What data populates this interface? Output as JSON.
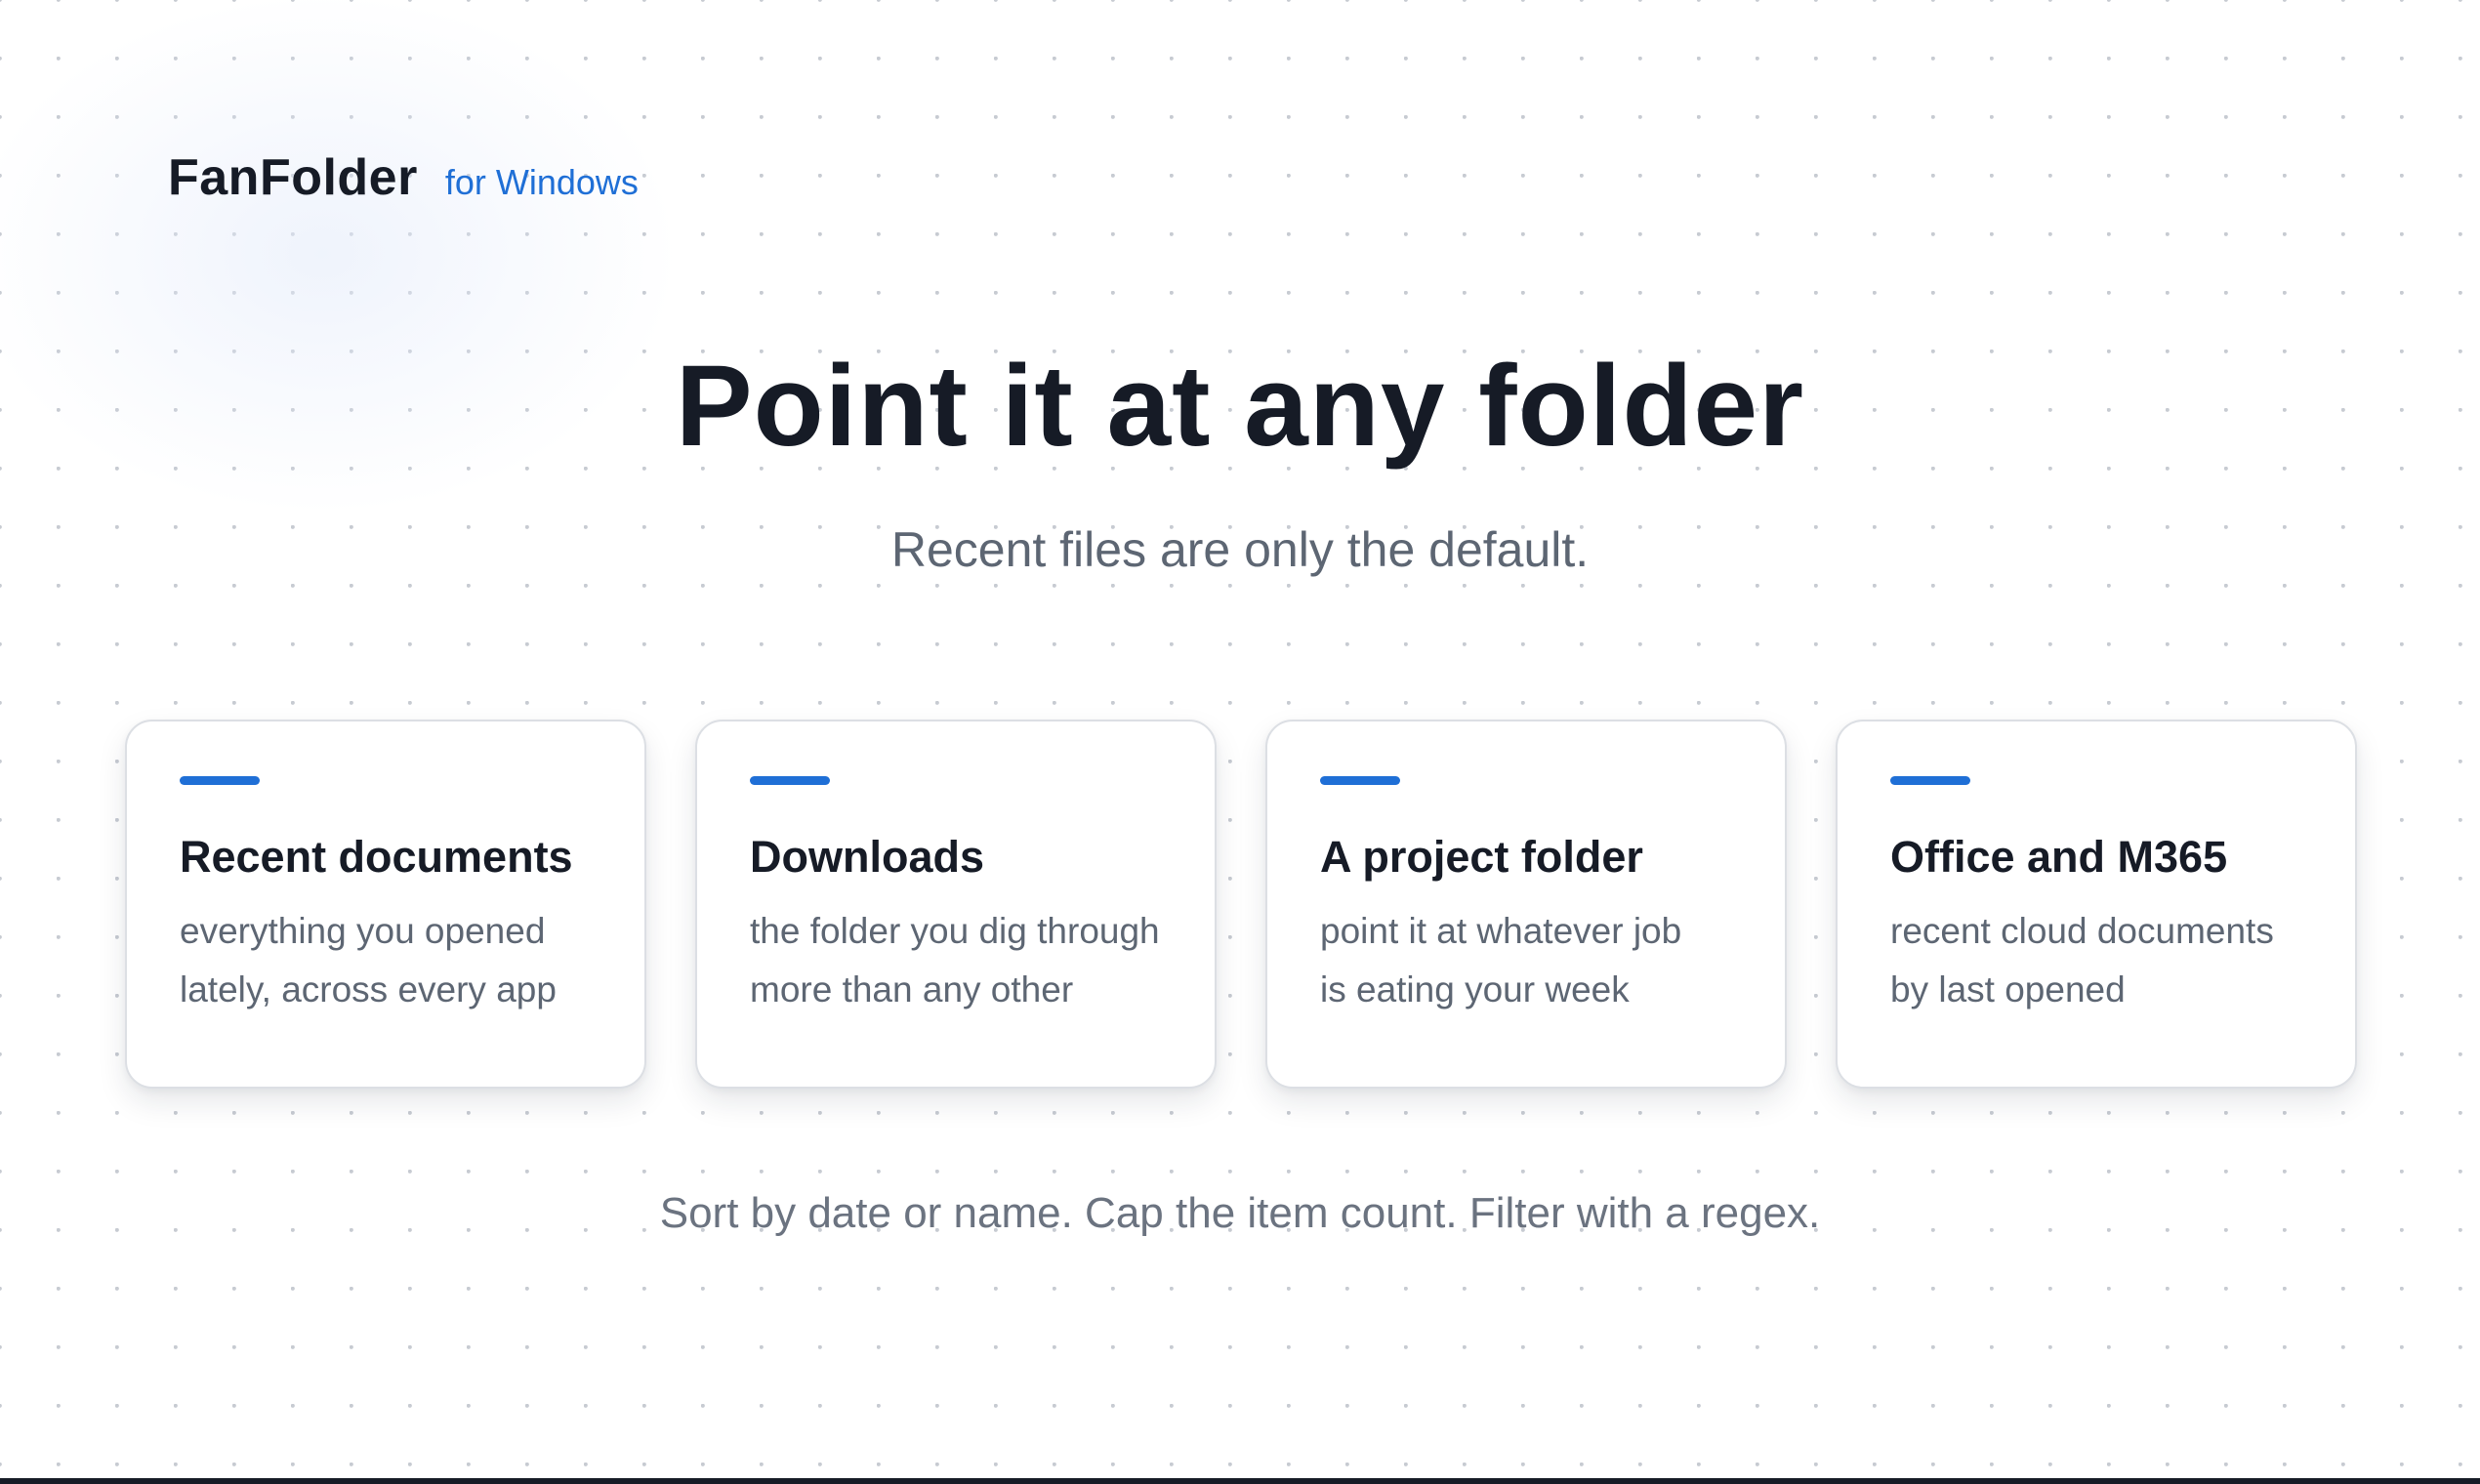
{
  "brand": {
    "name": "FanFolder",
    "tag": "for Windows"
  },
  "hero": {
    "headline": "Point it at any folder",
    "subhead": "Recent files are only the default."
  },
  "cards": [
    {
      "title": "Recent documents",
      "desc_line1": "everything you opened",
      "desc_line2": "lately, across every app"
    },
    {
      "title": "Downloads",
      "desc_line1": "the folder you dig through",
      "desc_line2": "more than any other"
    },
    {
      "title": "A project folder",
      "desc_line1": "point it at whatever job",
      "desc_line2": "is eating your week"
    },
    {
      "title": "Office and M365",
      "desc_line1": "recent cloud documents",
      "desc_line2": "by last opened"
    }
  ],
  "footnote": "Sort by date or name. Cap the item count. Filter with a regex.",
  "colors": {
    "accent": "#1f6fd6",
    "text": "#161b26",
    "muted": "#5d6673"
  }
}
